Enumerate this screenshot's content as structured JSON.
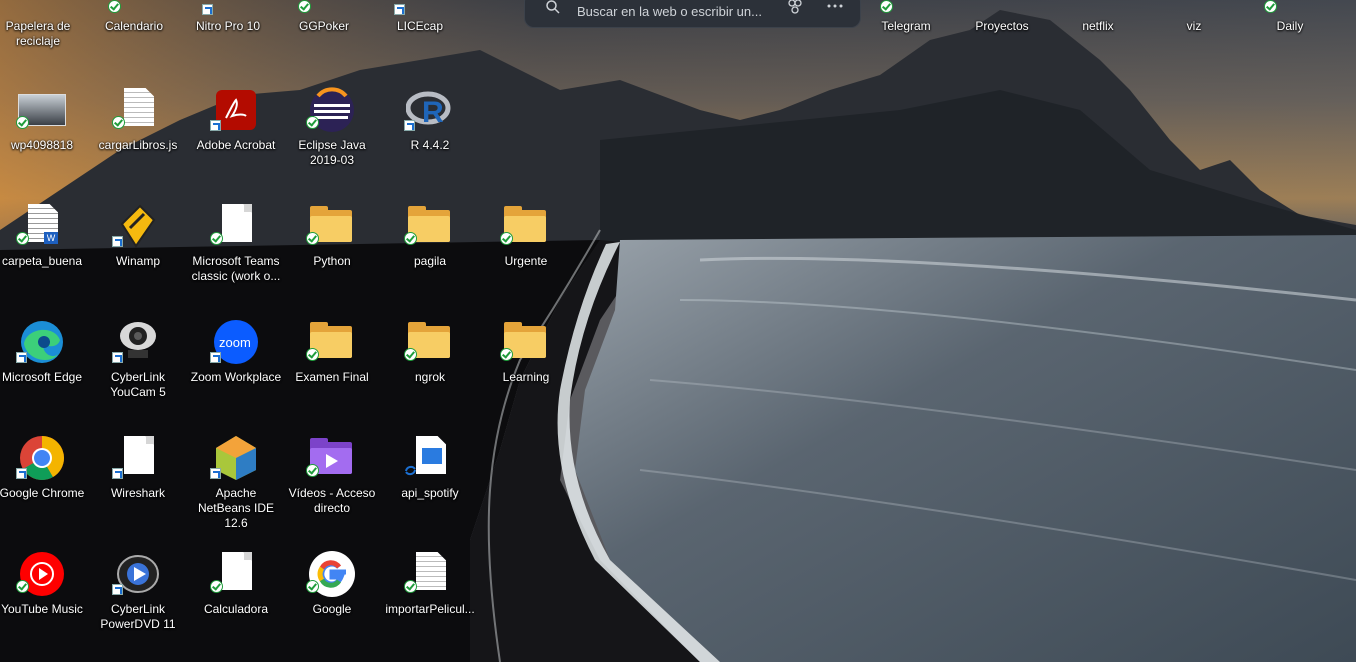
{
  "search": {
    "placeholder": "Buscar en la web o escribir un..."
  },
  "top_row": [
    {
      "id": "recycle",
      "label": "Papelera de reciclaje"
    },
    {
      "id": "calendar",
      "label": "Calendario"
    },
    {
      "id": "nitro",
      "label": "Nitro Pro 10"
    },
    {
      "id": "ggpoker",
      "label": "GGPoker"
    },
    {
      "id": "licecap",
      "label": "LICEcap"
    },
    {
      "id": "telegram",
      "label": "Telegram"
    },
    {
      "id": "proyectos",
      "label": "Proyectos"
    },
    {
      "id": "netflix",
      "label": "netflix"
    },
    {
      "id": "viz",
      "label": "viz"
    },
    {
      "id": "daily",
      "label": "Daily"
    }
  ],
  "desktop_icons": [
    {
      "label": "wp4098818",
      "icon": "image-thumbnail-icon",
      "kind": "image",
      "badge": "sync"
    },
    {
      "label": "cargarLibros.js",
      "icon": "js-file-icon",
      "kind": "textdoc",
      "badge": "sync"
    },
    {
      "label": "Adobe Acrobat",
      "icon": "adobe-acrobat-icon",
      "kind": "acrobat",
      "badge": "shortcut"
    },
    {
      "label": "Eclipse Java 2019-03",
      "icon": "eclipse-icon",
      "kind": "eclipse",
      "badge": "sync"
    },
    {
      "label": "R 4.4.2",
      "icon": "r-language-icon",
      "kind": "r",
      "badge": "shortcut"
    },
    {
      "label": "carpeta_buena",
      "icon": "word-document-icon",
      "kind": "word",
      "badge": "sync"
    },
    {
      "label": "Winamp",
      "icon": "winamp-icon",
      "kind": "winamp",
      "badge": "shortcut"
    },
    {
      "label": "Microsoft Teams classic (work o...",
      "icon": "blank-file-icon",
      "kind": "blank",
      "badge": "sync"
    },
    {
      "label": "Python",
      "icon": "folder-icon",
      "kind": "folder",
      "badge": "sync"
    },
    {
      "label": "pagila",
      "icon": "folder-icon",
      "kind": "folder",
      "badge": "sync"
    },
    {
      "label": "Urgente",
      "icon": "folder-icon",
      "kind": "folder",
      "badge": "sync"
    },
    {
      "label": "Microsoft Edge",
      "icon": "edge-icon",
      "kind": "edge",
      "badge": "shortcut"
    },
    {
      "label": "CyberLink YouCam 5",
      "icon": "webcam-icon",
      "kind": "youcam",
      "badge": "shortcut"
    },
    {
      "label": "Zoom Workplace",
      "icon": "zoom-icon",
      "kind": "zoom",
      "badge": "shortcut"
    },
    {
      "label": "Examen Final",
      "icon": "folder-icon",
      "kind": "folder",
      "badge": "sync"
    },
    {
      "label": "ngrok",
      "icon": "folder-icon",
      "kind": "folder",
      "badge": "sync"
    },
    {
      "label": "Learning",
      "icon": "folder-icon",
      "kind": "folder",
      "badge": "sync"
    },
    {
      "label": "Google Chrome",
      "icon": "chrome-icon",
      "kind": "chrome",
      "badge": "shortcut"
    },
    {
      "label": "Wireshark",
      "icon": "blank-file-icon",
      "kind": "blank",
      "badge": "shortcut"
    },
    {
      "label": "Apache NetBeans IDE 12.6",
      "icon": "netbeans-icon",
      "kind": "netbeans",
      "badge": "shortcut"
    },
    {
      "label": "Vídeos - Acceso directo",
      "icon": "videos-folder-icon",
      "kind": "videos",
      "badge": "sync"
    },
    {
      "label": "api_spotify",
      "icon": "image-file-icon",
      "kind": "imagefile",
      "badge": "syncing"
    },
    {
      "label": "YouTube Music",
      "icon": "youtube-music-icon",
      "kind": "ytmusic",
      "badge": "sync"
    },
    {
      "label": "CyberLink PowerDVD 11",
      "icon": "powerdvd-icon",
      "kind": "powerdvd",
      "badge": "shortcut"
    },
    {
      "label": "Calculadora",
      "icon": "blank-file-icon",
      "kind": "blank",
      "badge": "sync"
    },
    {
      "label": "Google",
      "icon": "google-icon",
      "kind": "google",
      "badge": "sync"
    },
    {
      "label": "importarPelicul...",
      "icon": "text-document-icon",
      "kind": "textdoc",
      "badge": "sync"
    }
  ]
}
